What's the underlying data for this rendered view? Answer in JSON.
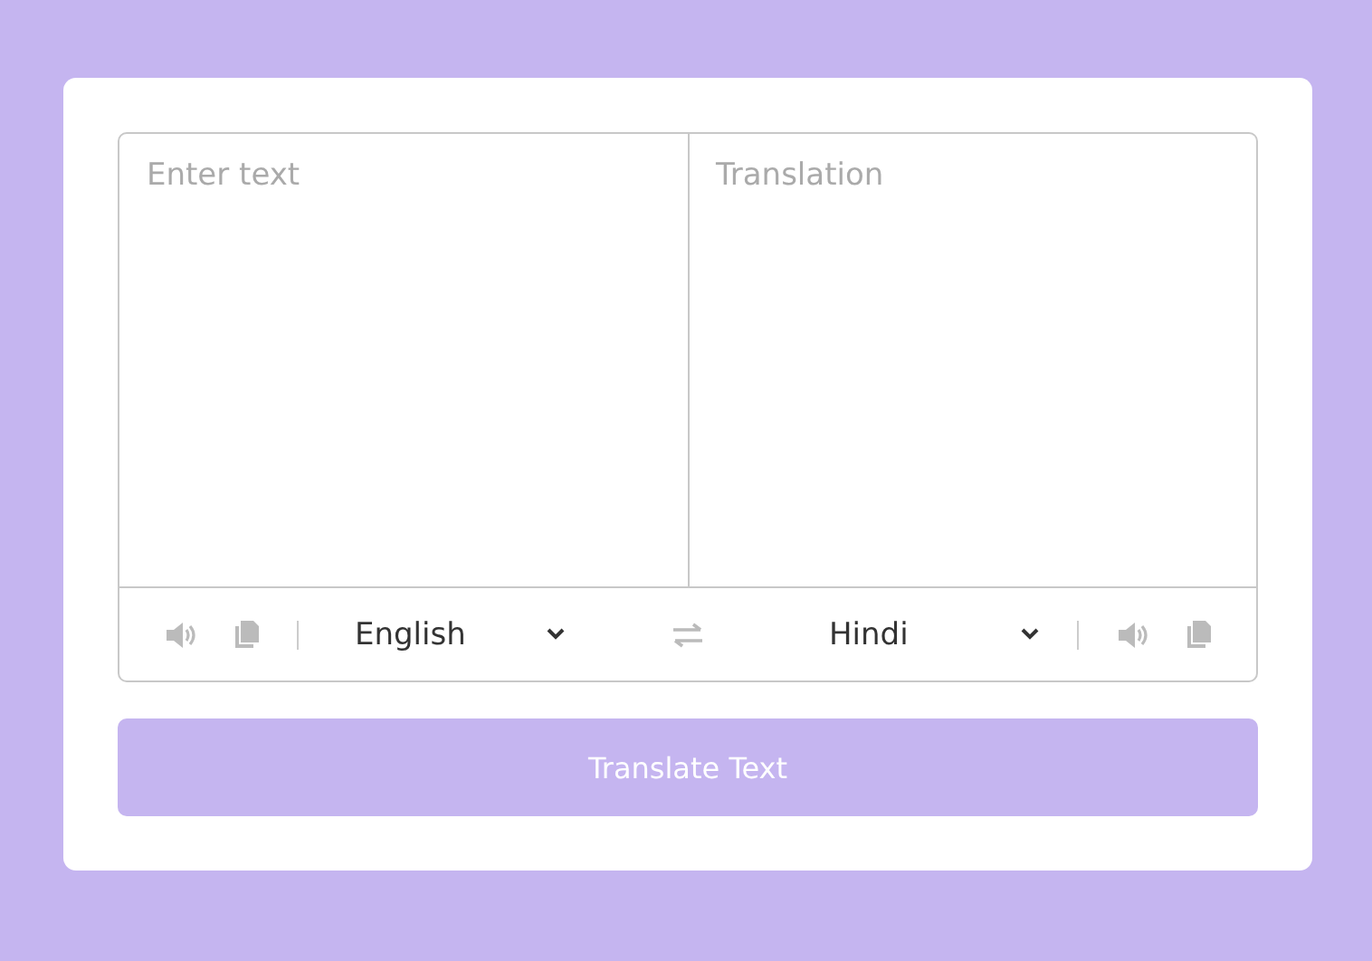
{
  "source": {
    "placeholder": "Enter text"
  },
  "target": {
    "placeholder": "Translation"
  },
  "controls": {
    "from_language": "English",
    "to_language": "Hindi"
  },
  "button": {
    "label": "Translate Text"
  }
}
